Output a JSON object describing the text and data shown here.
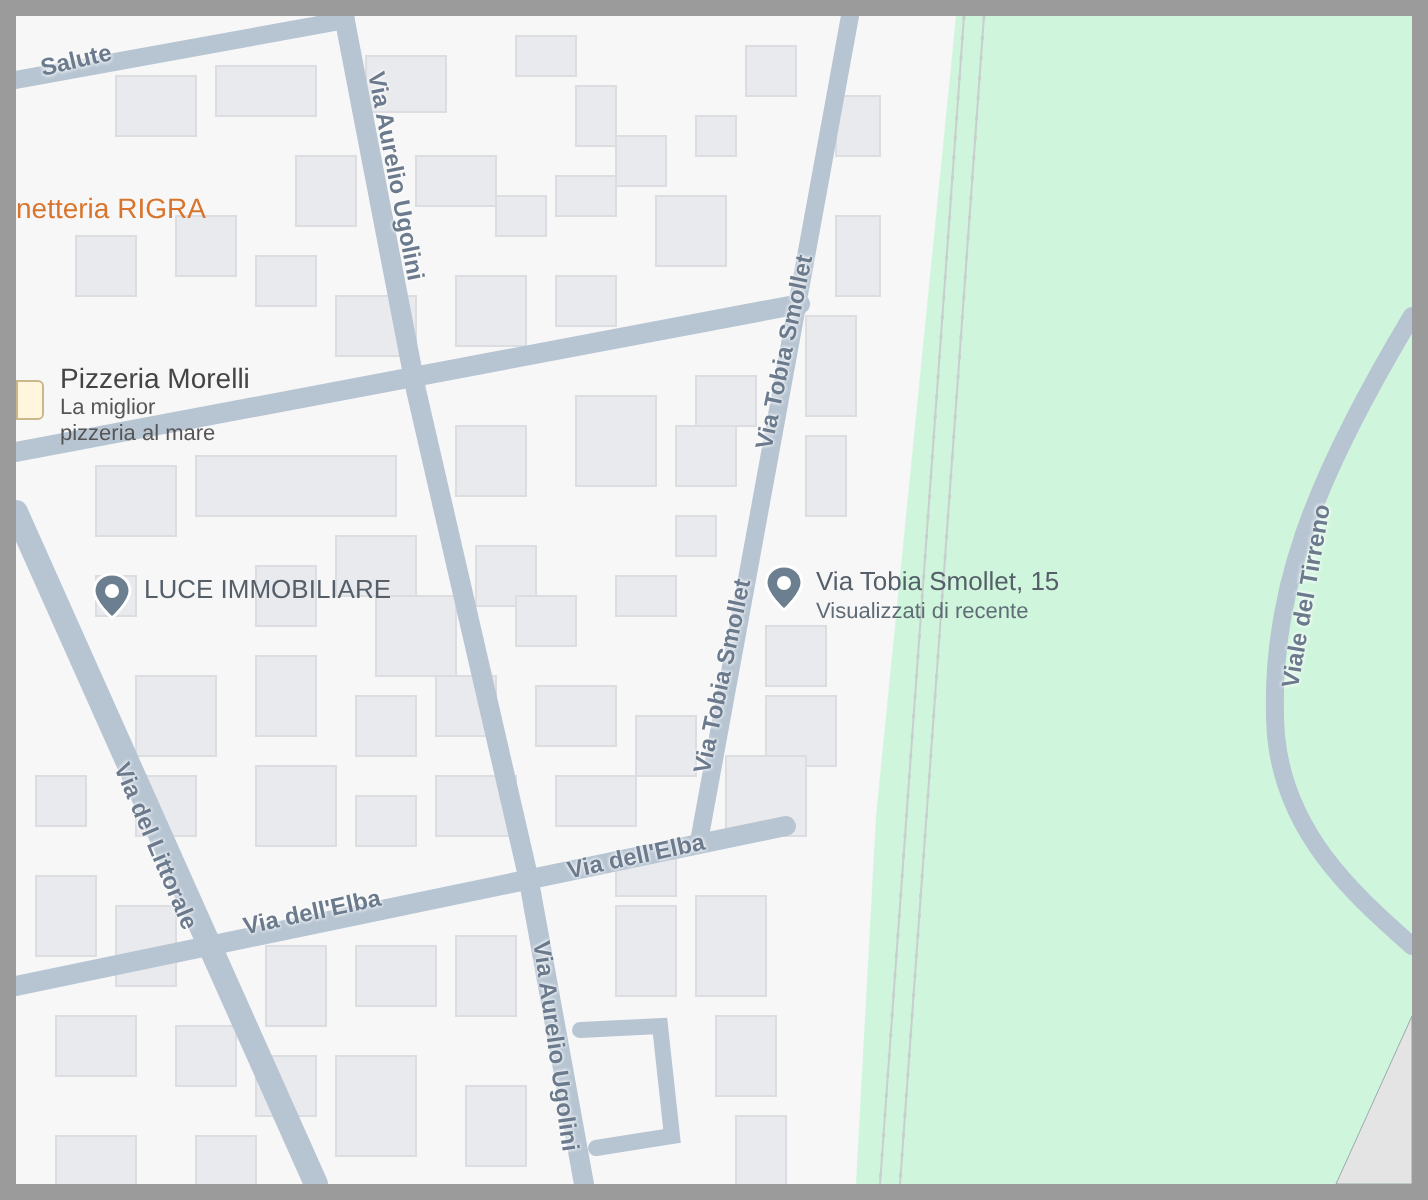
{
  "map": {
    "places": [
      {
        "kind": "shop",
        "name": "netteria RIGRA"
      },
      {
        "kind": "restaurant",
        "name": "Pizzeria Morelli",
        "subtitle": "La miglior pizzeria al mare"
      },
      {
        "kind": "pin",
        "name": "LUCE IMMOBILIARE"
      },
      {
        "kind": "pin",
        "name": "Via Tobia Smollet, 15",
        "subtitle": "Visualizzati di recente"
      }
    ],
    "streets": [
      {
        "name": "Salute"
      },
      {
        "name": "Via Aurelio Ugolini"
      },
      {
        "name": "Via Tobia Smollet"
      },
      {
        "name": "Via Tobia Smollet"
      },
      {
        "name": "Via del Littorale"
      },
      {
        "name": "Via dell'Elba"
      },
      {
        "name": "Via dell'Elba"
      },
      {
        "name": "Via Aurelio Ugolini"
      },
      {
        "name": "Viale del Tirreno"
      }
    ]
  }
}
